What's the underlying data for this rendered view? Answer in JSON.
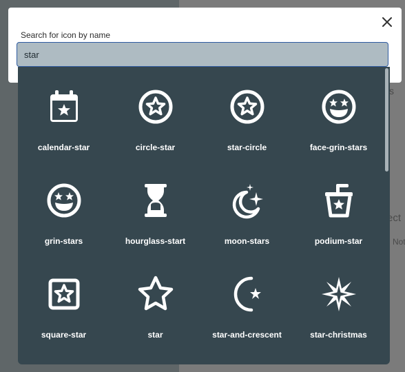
{
  "background": {
    "right_text_1": "s",
    "right_text_2": "ect",
    "right_text_3": "Not"
  },
  "dialog": {
    "search_label": "Search for icon by name",
    "search_value": "star",
    "close_icon": "close-icon"
  },
  "results": [
    {
      "name": "calendar-star",
      "icon": "calendar-star-icon"
    },
    {
      "name": "circle-star",
      "icon": "circle-star-icon"
    },
    {
      "name": "star-circle",
      "icon": "star-circle-icon"
    },
    {
      "name": "face-grin-stars",
      "icon": "face-grin-stars-icon"
    },
    {
      "name": "grin-stars",
      "icon": "grin-stars-icon"
    },
    {
      "name": "hourglass-start",
      "icon": "hourglass-start-icon"
    },
    {
      "name": "moon-stars",
      "icon": "moon-stars-icon"
    },
    {
      "name": "podium-star",
      "icon": "podium-star-icon"
    },
    {
      "name": "square-star",
      "icon": "square-star-icon"
    },
    {
      "name": "star",
      "icon": "star-icon"
    },
    {
      "name": "star-and-crescent",
      "icon": "star-and-crescent-icon"
    },
    {
      "name": "star-christmas",
      "icon": "star-christmas-icon"
    }
  ],
  "colors": {
    "panel": "#36474f",
    "icon": "#ffffff",
    "search_fill": "#aebbc2",
    "search_border": "#2d5aa0"
  }
}
